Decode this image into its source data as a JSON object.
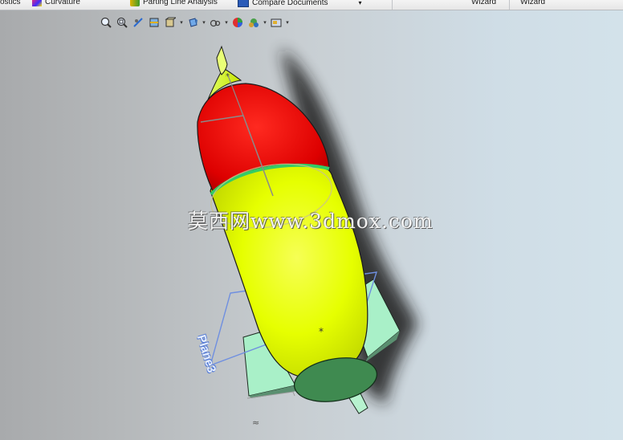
{
  "ribbon": {
    "items": [
      {
        "label": "ostics",
        "icon": "none"
      },
      {
        "label": "Curvature",
        "icon": "curvature-icon"
      },
      {
        "label": "Parting Line Analysis",
        "icon": "parting-line-icon"
      },
      {
        "label": "Compare Documents",
        "icon": "compare-documents-icon"
      },
      {
        "label": "Wizard",
        "icon": "none"
      },
      {
        "label": "Wizard",
        "icon": "none"
      }
    ]
  },
  "heads_up_toolbar": [
    "zoom-to-fit-icon",
    "zoom-to-area-icon",
    "previous-view-icon",
    "section-view-icon",
    "view-orientation-icon",
    "display-style-icon",
    "hide-show-items-icon",
    "edit-appearance-icon",
    "apply-scene-icon",
    "view-settings-icon"
  ],
  "model": {
    "plane_label": "Plane3",
    "nose_color": "#dd0000",
    "body_color": "#e6ff00",
    "fin_color": "#a9f0c8",
    "base_color": "#3f8a50",
    "edge_highlight": "#33cc66",
    "plane_color": "#6f8fe0"
  },
  "watermark": "莫西网www.3dmox.com"
}
